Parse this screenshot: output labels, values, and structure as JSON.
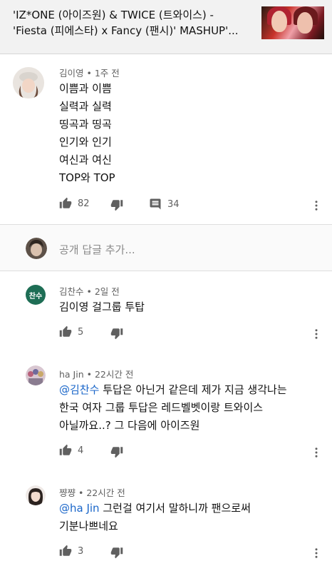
{
  "video": {
    "title_line1": "'IZ*ONE (아이즈원) & TWICE (트와이스) -",
    "title_line2": "'Fiesta (피에스타) x Fancy (팬시)' MASHUP'..."
  },
  "top_comment": {
    "author": "김이영",
    "time": "1주 전",
    "lines": [
      "이쁨과 이쁨",
      "실력과 실력",
      "띵곡과 띵곡",
      "인기와 인기",
      "여신과 여신",
      "TOP와 TOP"
    ],
    "likes": "82",
    "replies": "34"
  },
  "reply_input": {
    "placeholder": "공개 답글 추가..."
  },
  "replies": [
    {
      "author": "김찬수",
      "time": "2일 전",
      "avatar_text": "찬수",
      "avatar_color": "#1e6e55",
      "lines": [
        "김이영 걸그룹 투탑"
      ],
      "likes": "5"
    },
    {
      "author": "ha Jin",
      "time": "22시간 전",
      "mention": "@김찬수",
      "lines": [
        "투답은 아닌거 같은데 제가 지금 생각나는",
        "한국 여자 그룹 투답은 레드벨벳이랑 트와이스",
        "아닐까요..? 그 다음에 아이즈원"
      ],
      "likes": "4"
    },
    {
      "author": "쨩쨩",
      "time": "22시간 전",
      "mention": "@ha Jin",
      "lines": [
        "그런걸 여기서 말하니까 팬으로써",
        "기분나쁘네요"
      ],
      "likes": "3"
    }
  ],
  "separator": "•",
  "colors": {
    "mention": "#1a66c9",
    "meta": "#606060",
    "header_bg": "#f2f2f2"
  }
}
